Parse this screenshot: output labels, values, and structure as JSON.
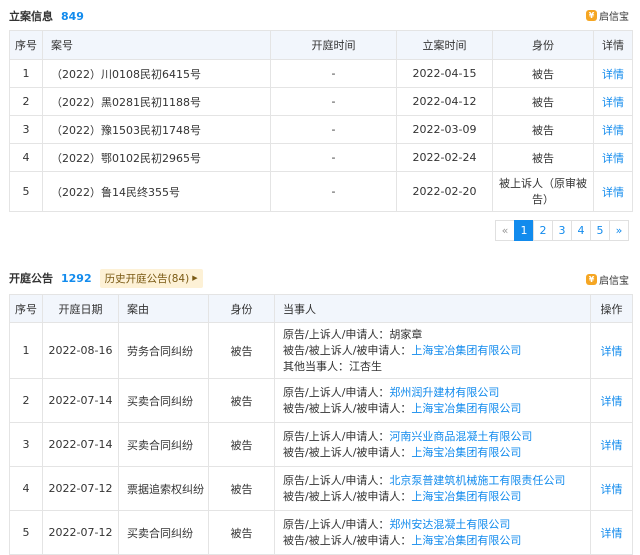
{
  "filing": {
    "title": "立案信息",
    "count": "849",
    "brand": "启信宝",
    "columns": [
      "序号",
      "案号",
      "开庭时间",
      "立案时间",
      "身份",
      "详情"
    ],
    "rows": [
      {
        "no": "1",
        "case": "（2022）川0108民初6415号",
        "hearing": "-",
        "filed": "2022-04-15",
        "role": "被告",
        "detail": "详情"
      },
      {
        "no": "2",
        "case": "（2022）黑0281民初1188号",
        "hearing": "-",
        "filed": "2022-04-12",
        "role": "被告",
        "detail": "详情"
      },
      {
        "no": "3",
        "case": "（2022）豫1503民初1748号",
        "hearing": "-",
        "filed": "2022-03-09",
        "role": "被告",
        "detail": "详情"
      },
      {
        "no": "4",
        "case": "（2022）鄂0102民初2965号",
        "hearing": "-",
        "filed": "2022-02-24",
        "role": "被告",
        "detail": "详情"
      },
      {
        "no": "5",
        "case": "（2022）鲁14民终355号",
        "hearing": "-",
        "filed": "2022-02-20",
        "role": "被上诉人（原审被告）",
        "detail": "详情"
      }
    ]
  },
  "pagination": {
    "prev": "«",
    "pages": [
      "1",
      "2",
      "3",
      "4",
      "5"
    ],
    "next": "»",
    "current": 1
  },
  "hearing": {
    "title": "开庭公告",
    "count": "1292",
    "history_label": "历史开庭公告(84)",
    "brand": "启信宝",
    "columns": [
      "序号",
      "开庭日期",
      "案由",
      "身份",
      "当事人",
      "操作"
    ],
    "rows": [
      {
        "no": "1",
        "date": "2022-08-16",
        "cause": "劳务合同纠纷",
        "role": "被告",
        "action": "详情",
        "parties": [
          {
            "label": "原告/上诉人/申请人：",
            "name": "胡家章",
            "link": false
          },
          {
            "label": "被告/被上诉人/被申请人：",
            "name": "上海宝冶集团有限公司",
            "link": true
          },
          {
            "label": "其他当事人：",
            "name": "江杏生",
            "link": false
          }
        ]
      },
      {
        "no": "2",
        "date": "2022-07-14",
        "cause": "买卖合同纠纷",
        "role": "被告",
        "action": "详情",
        "parties": [
          {
            "label": "原告/上诉人/申请人：",
            "name": "郑州润升建材有限公司",
            "link": true
          },
          {
            "label": "被告/被上诉人/被申请人：",
            "name": "上海宝冶集团有限公司",
            "link": true
          }
        ]
      },
      {
        "no": "3",
        "date": "2022-07-14",
        "cause": "买卖合同纠纷",
        "role": "被告",
        "action": "详情",
        "parties": [
          {
            "label": "原告/上诉人/申请人：",
            "name": "河南兴业商品混凝土有限公司",
            "link": true
          },
          {
            "label": "被告/被上诉人/被申请人：",
            "name": "上海宝冶集团有限公司",
            "link": true
          }
        ]
      },
      {
        "no": "4",
        "date": "2022-07-12",
        "cause": "票据追索权纠纷",
        "role": "被告",
        "action": "详情",
        "parties": [
          {
            "label": "原告/上诉人/申请人：",
            "name": "北京泵普建筑机械施工有限责任公司",
            "link": true
          },
          {
            "label": "被告/被上诉人/被申请人：",
            "name": "上海宝冶集团有限公司",
            "link": true
          }
        ]
      },
      {
        "no": "5",
        "date": "2022-07-12",
        "cause": "买卖合同纠纷",
        "role": "被告",
        "action": "详情",
        "parties": [
          {
            "label": "原告/上诉人/申请人：",
            "name": "郑州安达混凝土有限公司",
            "link": true
          },
          {
            "label": "被告/被上诉人/被申请人：",
            "name": "上海宝冶集团有限公司",
            "link": true
          }
        ]
      }
    ]
  },
  "colors": {
    "accent": "#128bed",
    "header_bg": "#f2f6fc",
    "tag_bg": "#fdf1d6",
    "brand": "#f5a623"
  }
}
